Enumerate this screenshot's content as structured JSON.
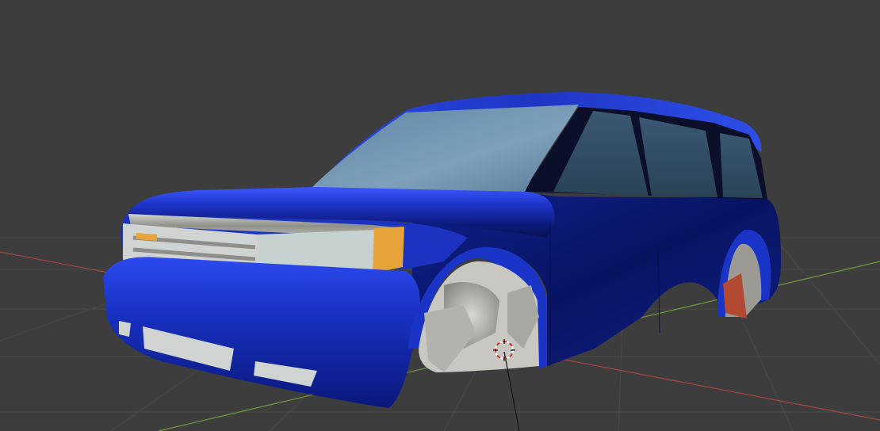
{
  "viewport": {
    "mode": "3d-viewport",
    "background_color": "#3d3d3d",
    "grid_color": "#4a4a4a",
    "x_axis_color": "#b34a4a",
    "y_axis_color": "#6f9a3c",
    "z_axis_color": "#1b1b1b",
    "cursor_icon": "3d-cursor-icon",
    "model": {
      "object": "suv-car-body",
      "body_color": "#1a34c8",
      "window_color": "#6f93ad",
      "headlight_color": "#c9d3d3",
      "indicator_color": "#e7a43a",
      "grille_color": "#a7a7a3"
    }
  }
}
